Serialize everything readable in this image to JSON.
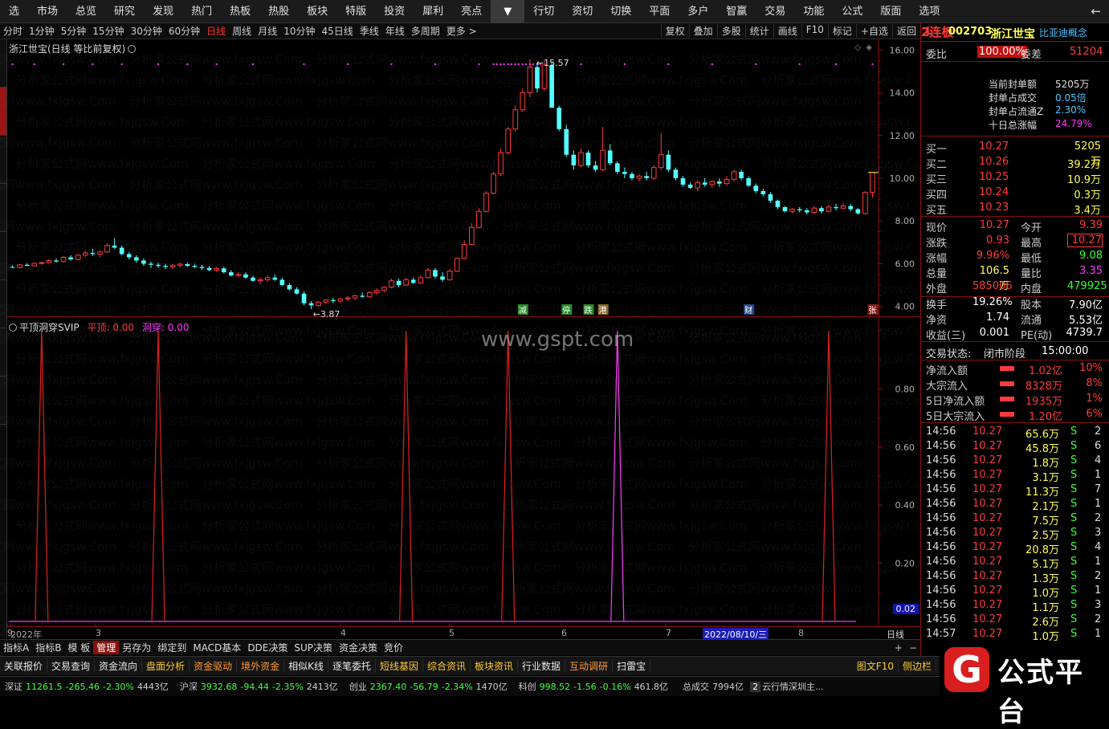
{
  "nav": [
    "选",
    "市场",
    "总览",
    "研究",
    "发现",
    "热门",
    "热板",
    "热股",
    "板块",
    "特版",
    "投资",
    "犀利",
    "亮点",
    "▼",
    "行切",
    "资切",
    "切换",
    "平面",
    "多户",
    "智赢",
    "交易",
    "功能",
    "公式",
    "版面",
    "选项"
  ],
  "nav_back": "←",
  "timeframes": [
    "分时",
    "1分钟",
    "5分钟",
    "15分钟",
    "30分钟",
    "60分钟",
    "日线",
    "周线",
    "月线",
    "10分钟",
    "45日线",
    "季线",
    "年线",
    "多周期",
    "更多 >"
  ],
  "active_timeframe": "日线",
  "chart_tools": [
    "复权",
    "叠加",
    "多股",
    "统计",
    "画线",
    "F10",
    "标记",
    "+自选",
    "返回"
  ],
  "chart_title": "浙江世宝(日线 等比前复权)",
  "price_axis": [
    "16.00",
    "14.00",
    "12.00",
    "10.00",
    "8.00",
    "6.00",
    "4.00"
  ],
  "annotations": {
    "high": "15.57",
    "low": "3.87"
  },
  "event_markers": [
    "减",
    "停",
    "跌",
    "港",
    "财",
    "张"
  ],
  "indicator": {
    "name": "平顶洞穿SVIP",
    "pd_label": "平顶:",
    "pd_value": "0.00",
    "dc_label": "洞穿:",
    "dc_value": "0.00"
  },
  "indicator_axis": [
    "0.80",
    "0.60",
    "0.40",
    "0.20"
  ],
  "indicator_current": "0.02",
  "x_labels": [
    "2022年",
    "3",
    "4",
    "5",
    "6",
    "7",
    "8",
    "9"
  ],
  "cursor_date": "2022/08/10/三",
  "period_label": "日线",
  "watermark_center": "www.gspt.com",
  "watermark_text": "分析家公式网www.fxjgsw.Com",
  "indicator_bar": [
    "指标A",
    "指标B",
    "模 板",
    "管理",
    "另存为",
    "绑定到",
    "MACD基本",
    "DDE决策",
    "SUP决策",
    "资金决策",
    "竞价"
  ],
  "indicator_bar_active": "管理",
  "func_bar": [
    "关联报价",
    "交易查询",
    "资金流向",
    "盘面分析",
    "资金驱动",
    "境外资金",
    "相似K线",
    "逐笔委托",
    "短线基因",
    "综合资讯",
    "板块资讯",
    "行业数据",
    "互动调研",
    "扫雷宝"
  ],
  "func_bar_right": [
    "图文F10",
    "侧边栏"
  ],
  "status_bar": {
    "indices": [
      {
        "name": "深证",
        "v": "11261.5",
        "chg": "-265.46",
        "pct": "-2.30%",
        "amt": "4443亿"
      },
      {
        "name": "沪深",
        "v": "3932.68",
        "chg": "-94.44",
        "pct": "-2.35%",
        "amt": "2413亿"
      },
      {
        "name": "创业",
        "v": "2367.40",
        "chg": "-56.79",
        "pct": "-2.34%",
        "amt": "1470亿"
      },
      {
        "name": "科创",
        "v": "998.52",
        "chg": "-1.56",
        "pct": "-0.16%",
        "amt": "461.8亿"
      }
    ],
    "total_label": "总成交",
    "total": "7994亿",
    "news_count": "2",
    "news": "云行情深圳主..."
  },
  "stock": {
    "code": "002703",
    "name": "浙江世宝",
    "concept": "比亚迪概念",
    "flag": "L"
  },
  "order_ratio": {
    "label1": "委比",
    "v1": "100.00%",
    "label2": "委差",
    "v2": "51204"
  },
  "limit_up": {
    "streak": "2连板",
    "items": [
      {
        "k": "当前封单额",
        "v": "5205万"
      },
      {
        "k": "封单占成交",
        "v": "0.05倍"
      },
      {
        "k": "封单占流通Z",
        "v": "2.30%"
      },
      {
        "k": "十日总涨幅",
        "v": "24.79%"
      }
    ]
  },
  "bids": [
    {
      "l": "买一",
      "p": "10.27",
      "v": "5205万"
    },
    {
      "l": "买二",
      "p": "10.26",
      "v": "39.2万"
    },
    {
      "l": "买三",
      "p": "10.25",
      "v": "10.9万"
    },
    {
      "l": "买四",
      "p": "10.24",
      "v": "0.3万"
    },
    {
      "l": "买五",
      "p": "10.23",
      "v": "3.4万"
    }
  ],
  "quote": [
    {
      "l1": "现价",
      "v1": "10.27",
      "l2": "今开",
      "v2": "9.39"
    },
    {
      "l1": "涨跌",
      "v1": "0.93",
      "l2": "最高",
      "v2": "10.27"
    },
    {
      "l1": "涨幅",
      "v1": "9.96%",
      "l2": "最低",
      "v2": "9.08"
    },
    {
      "l1": "总量",
      "v1": "106.5万",
      "l2": "量比",
      "v2": "3.35"
    },
    {
      "l1": "外盘",
      "v1": "585006",
      "l2": "内盘",
      "v2": "479925"
    }
  ],
  "fundamentals": [
    {
      "l1": "换手",
      "v1": "19.26%",
      "l2": "股本",
      "v2": "7.90亿"
    },
    {
      "l1": "净资",
      "v1": "1.74",
      "l2": "流通",
      "v2": "5.53亿"
    },
    {
      "l1": "收益(三)",
      "v1": "0.001",
      "l2": "PE(动)",
      "v2": "4739.7"
    }
  ],
  "trade_status": {
    "label": "交易状态:",
    "stage": "闭市阶段",
    "time": "15:00:00"
  },
  "flows": [
    {
      "l": "净流入额",
      "v": "1.02亿",
      "p": "10%"
    },
    {
      "l": "大宗流入",
      "v": "8328万",
      "p": "8%"
    },
    {
      "l": "5日净流入额",
      "v": "1935万",
      "p": "1%"
    },
    {
      "l": "5日大宗流入",
      "v": "1.20亿",
      "p": "6%"
    }
  ],
  "ticks": [
    {
      "t": "14:56",
      "p": "10.27",
      "v": "65.6万",
      "s": "S",
      "n": "2"
    },
    {
      "t": "14:56",
      "p": "10.27",
      "v": "45.8万",
      "s": "S",
      "n": "6"
    },
    {
      "t": "14:56",
      "p": "10.27",
      "v": "1.8万",
      "s": "S",
      "n": "4"
    },
    {
      "t": "14:56",
      "p": "10.27",
      "v": "3.1万",
      "s": "S",
      "n": "1"
    },
    {
      "t": "14:56",
      "p": "10.27",
      "v": "11.3万",
      "s": "S",
      "n": "7"
    },
    {
      "t": "14:56",
      "p": "10.27",
      "v": "2.1万",
      "s": "S",
      "n": "1"
    },
    {
      "t": "14:56",
      "p": "10.27",
      "v": "7.5万",
      "s": "S",
      "n": "2"
    },
    {
      "t": "14:56",
      "p": "10.27",
      "v": "2.5万",
      "s": "S",
      "n": "3"
    },
    {
      "t": "14:56",
      "p": "10.27",
      "v": "20.8万",
      "s": "S",
      "n": "4"
    },
    {
      "t": "14:56",
      "p": "10.27",
      "v": "5.1万",
      "s": "S",
      "n": "1"
    },
    {
      "t": "14:56",
      "p": "10.27",
      "v": "1.3万",
      "s": "S",
      "n": "2"
    },
    {
      "t": "14:56",
      "p": "10.27",
      "v": "1.0万",
      "s": "S",
      "n": "1"
    },
    {
      "t": "14:56",
      "p": "10.27",
      "v": "1.1万",
      "s": "S",
      "n": "3"
    },
    {
      "t": "14:56",
      "p": "10.27",
      "v": "2.6万",
      "s": "S",
      "n": "2"
    },
    {
      "t": "14:57",
      "p": "10.27",
      "v": "1.0万",
      "s": "S",
      "n": "1"
    }
  ],
  "logo": {
    "glyph": "G",
    "text": "公式平台"
  },
  "colors": {
    "up": "#ff3b3b",
    "down": "#54ffff",
    "pink": "#ff3bff",
    "yellow": "#ffff54",
    "green": "#3bff3b"
  },
  "chart_data": {
    "type": "candlestick",
    "title": "浙江世宝(日线 等比前复权)",
    "ylim": [
      3.5,
      16.5
    ],
    "candles": [
      [
        5.85,
        5.92,
        5.8,
        5.82
      ],
      [
        5.82,
        5.98,
        5.78,
        5.95
      ],
      [
        5.95,
        6.02,
        5.88,
        5.9
      ],
      [
        5.9,
        6.05,
        5.86,
        6.02
      ],
      [
        6.02,
        6.1,
        5.95,
        6.05
      ],
      [
        6.05,
        6.2,
        6.0,
        6.15
      ],
      [
        6.15,
        6.25,
        6.05,
        6.1
      ],
      [
        6.1,
        6.35,
        6.05,
        6.3
      ],
      [
        6.3,
        6.4,
        6.15,
        6.2
      ],
      [
        6.2,
        6.45,
        6.15,
        6.4
      ],
      [
        6.4,
        6.6,
        6.3,
        6.5
      ],
      [
        6.5,
        6.7,
        6.35,
        6.45
      ],
      [
        6.45,
        6.6,
        6.3,
        6.55
      ],
      [
        6.55,
        6.95,
        6.5,
        6.85
      ],
      [
        6.85,
        7.2,
        6.7,
        6.75
      ],
      [
        6.75,
        6.85,
        6.4,
        6.45
      ],
      [
        6.45,
        6.55,
        6.2,
        6.3
      ],
      [
        6.3,
        6.4,
        6.05,
        6.15
      ],
      [
        6.15,
        6.25,
        5.9,
        6.0
      ],
      [
        6.0,
        6.1,
        5.8,
        5.95
      ],
      [
        5.95,
        6.05,
        5.8,
        5.9
      ],
      [
        5.9,
        6.0,
        5.75,
        5.85
      ],
      [
        5.85,
        6.0,
        5.75,
        5.92
      ],
      [
        5.92,
        6.05,
        5.82,
        5.98
      ],
      [
        5.98,
        6.05,
        5.85,
        5.9
      ],
      [
        5.9,
        6.0,
        5.8,
        5.85
      ],
      [
        5.85,
        5.95,
        5.7,
        5.8
      ],
      [
        5.8,
        5.9,
        5.65,
        5.7
      ],
      [
        5.7,
        5.85,
        5.62,
        5.78
      ],
      [
        5.78,
        5.85,
        5.55,
        5.6
      ],
      [
        5.6,
        5.7,
        5.4,
        5.45
      ],
      [
        5.45,
        5.6,
        5.35,
        5.5
      ],
      [
        5.5,
        5.6,
        5.3,
        5.35
      ],
      [
        5.35,
        5.45,
        5.15,
        5.2
      ],
      [
        5.2,
        5.35,
        5.05,
        5.25
      ],
      [
        5.25,
        5.45,
        5.15,
        5.35
      ],
      [
        5.35,
        5.5,
        5.2,
        5.25
      ],
      [
        5.25,
        5.35,
        4.95,
        5.0
      ],
      [
        5.0,
        5.1,
        4.75,
        4.8
      ],
      [
        4.8,
        4.9,
        4.55,
        4.6
      ],
      [
        4.6,
        4.7,
        4.05,
        4.15
      ],
      [
        4.15,
        4.25,
        3.87,
        4.05
      ],
      [
        4.05,
        4.25,
        4.0,
        4.2
      ],
      [
        4.2,
        4.35,
        4.1,
        4.3
      ],
      [
        4.3,
        4.4,
        4.15,
        4.25
      ],
      [
        4.25,
        4.4,
        4.15,
        4.35
      ],
      [
        4.35,
        4.5,
        4.25,
        4.4
      ],
      [
        4.4,
        4.55,
        4.3,
        4.5
      ],
      [
        4.5,
        4.65,
        4.4,
        4.45
      ],
      [
        4.45,
        4.7,
        4.4,
        4.65
      ],
      [
        4.65,
        4.85,
        4.55,
        4.75
      ],
      [
        4.75,
        4.95,
        4.65,
        4.9
      ],
      [
        4.9,
        5.3,
        4.85,
        5.2
      ],
      [
        5.2,
        5.3,
        4.9,
        5.0
      ],
      [
        5.0,
        5.35,
        4.95,
        5.25
      ],
      [
        5.25,
        5.35,
        5.05,
        5.1
      ],
      [
        5.1,
        5.45,
        5.05,
        5.35
      ],
      [
        5.35,
        5.8,
        5.3,
        5.7
      ],
      [
        5.7,
        5.8,
        5.3,
        5.4
      ],
      [
        5.4,
        5.6,
        5.15,
        5.25
      ],
      [
        5.25,
        5.75,
        5.2,
        5.65
      ],
      [
        5.65,
        6.3,
        5.6,
        6.25
      ],
      [
        6.25,
        7.1,
        6.2,
        6.9
      ],
      [
        6.9,
        7.9,
        6.9,
        7.7
      ],
      [
        7.7,
        8.6,
        7.65,
        8.45
      ],
      [
        8.45,
        9.4,
        8.4,
        9.3
      ],
      [
        9.3,
        10.3,
        9.25,
        10.2
      ],
      [
        10.2,
        11.4,
        10.1,
        11.2
      ],
      [
        11.2,
        12.4,
        11.1,
        12.3
      ],
      [
        12.3,
        13.4,
        12.2,
        13.2
      ],
      [
        13.2,
        14.2,
        13.1,
        14.0
      ],
      [
        14.0,
        15.57,
        13.8,
        15.2
      ],
      [
        15.2,
        15.4,
        14.0,
        14.2
      ],
      [
        14.2,
        15.5,
        14.1,
        15.3
      ],
      [
        15.3,
        15.45,
        13.3,
        13.3
      ],
      [
        13.3,
        13.4,
        12.2,
        12.3
      ],
      [
        12.3,
        12.5,
        11.0,
        11.1
      ],
      [
        11.1,
        11.3,
        10.4,
        10.6
      ],
      [
        10.6,
        11.4,
        10.5,
        11.2
      ],
      [
        11.2,
        11.3,
        10.5,
        10.6
      ],
      [
        10.6,
        10.8,
        10.3,
        10.4
      ],
      [
        10.4,
        12.4,
        10.3,
        11.3
      ],
      [
        11.3,
        11.6,
        10.6,
        10.7
      ],
      [
        10.7,
        10.8,
        10.2,
        10.3
      ],
      [
        10.3,
        10.5,
        10.0,
        10.2
      ],
      [
        10.2,
        10.3,
        9.9,
        10.0
      ],
      [
        10.0,
        10.2,
        9.85,
        10.1
      ],
      [
        10.1,
        10.3,
        9.9,
        10.0
      ],
      [
        10.0,
        10.6,
        9.95,
        10.5
      ],
      [
        10.5,
        12.1,
        10.4,
        11.1
      ],
      [
        11.1,
        11.3,
        10.3,
        10.4
      ],
      [
        10.4,
        10.5,
        9.9,
        10.0
      ],
      [
        10.0,
        10.1,
        9.6,
        9.7
      ],
      [
        9.7,
        9.8,
        9.5,
        9.55
      ],
      [
        9.55,
        9.9,
        9.4,
        9.8
      ],
      [
        9.8,
        10.0,
        9.6,
        9.7
      ],
      [
        9.7,
        9.9,
        9.55,
        9.85
      ],
      [
        9.85,
        10.0,
        9.6,
        9.75
      ],
      [
        9.75,
        10.1,
        9.65,
        9.95
      ],
      [
        9.95,
        10.4,
        9.85,
        10.3
      ],
      [
        10.3,
        10.4,
        9.9,
        10.0
      ],
      [
        10.0,
        10.1,
        9.6,
        9.65
      ],
      [
        9.65,
        9.75,
        9.3,
        9.4
      ],
      [
        9.4,
        9.5,
        9.15,
        9.25
      ],
      [
        9.25,
        9.35,
        8.85,
        8.95
      ],
      [
        8.95,
        9.0,
        8.55,
        8.65
      ],
      [
        8.65,
        8.7,
        8.4,
        8.45
      ],
      [
        8.45,
        8.6,
        8.35,
        8.55
      ],
      [
        8.55,
        8.65,
        8.4,
        8.5
      ],
      [
        8.5,
        8.6,
        8.3,
        8.4
      ],
      [
        8.4,
        8.7,
        8.35,
        8.6
      ],
      [
        8.6,
        8.7,
        8.35,
        8.45
      ],
      [
        8.45,
        8.75,
        8.4,
        8.65
      ],
      [
        8.65,
        8.8,
        8.5,
        8.6
      ],
      [
        8.6,
        8.85,
        8.55,
        8.7
      ],
      [
        8.7,
        8.8,
        8.45,
        8.55
      ],
      [
        8.55,
        8.6,
        8.3,
        8.35
      ],
      [
        8.35,
        9.39,
        8.3,
        9.34
      ],
      [
        9.34,
        10.27,
        9.08,
        10.27
      ]
    ],
    "indicator_series": [
      {
        "name": "平顶",
        "color": "red",
        "spike_at": [
          4,
          20,
          54,
          68,
          112
        ]
      },
      {
        "name": "洞穿",
        "color": "magenta",
        "spike_at": [
          83
        ]
      }
    ]
  }
}
